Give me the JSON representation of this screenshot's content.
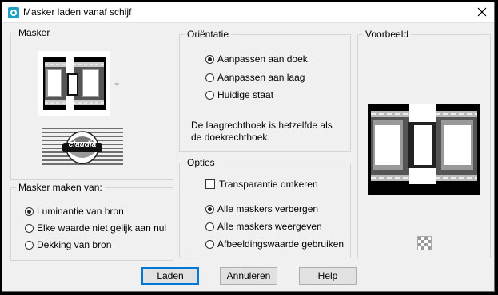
{
  "window": {
    "title": "Masker laden vanaf schijf",
    "icon": "app-icon",
    "close_icon": "close-icon"
  },
  "masker": {
    "label": "Masker",
    "logo_text": "claudia"
  },
  "masker_van": {
    "label": "Masker maken van:",
    "options": [
      {
        "label": "Luminantie van bron",
        "selected": true
      },
      {
        "label": "Elke waarde niet gelijk aan nul",
        "selected": false
      },
      {
        "label": "Dekking van bron",
        "selected": false
      }
    ]
  },
  "orientatie": {
    "label": "Oriëntatie",
    "options": [
      {
        "label": "Aanpassen aan doek",
        "selected": true
      },
      {
        "label": "Aanpassen aan laag",
        "selected": false
      },
      {
        "label": "Huidige staat",
        "selected": false
      }
    ],
    "description_line1": "De laagrechthoek is hetzelfde als",
    "description_line2": "de doekrechthoek."
  },
  "opties": {
    "label": "Opties",
    "checkbox": {
      "label": "Transparantie omkeren",
      "checked": false
    },
    "options": [
      {
        "label": "Alle maskers verbergen",
        "selected": true
      },
      {
        "label": "Alle maskers weergeven",
        "selected": false
      },
      {
        "label": "Afbeeldingswaarde gebruiken",
        "selected": false
      }
    ]
  },
  "voorbeeld": {
    "label": "Voorbeeld"
  },
  "buttons": {
    "load": "Laden",
    "cancel": "Annuleren",
    "help": "Help"
  }
}
